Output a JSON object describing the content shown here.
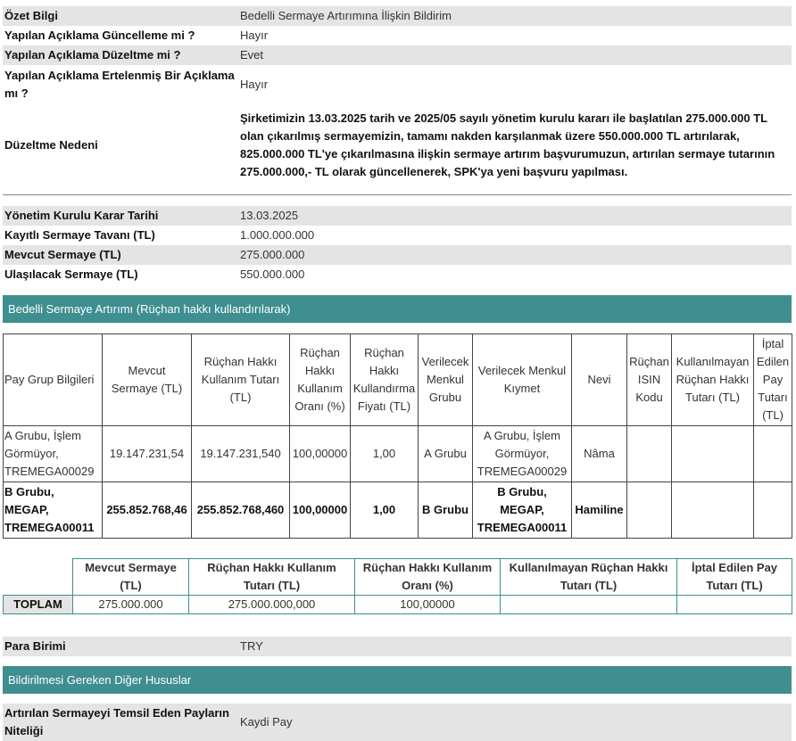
{
  "summary": {
    "rows": [
      {
        "key": "Özet Bilgi",
        "value": "Bedelli Sermaye Artırımına İlişkin Bildirim"
      },
      {
        "key": "Yapılan Açıklama Güncelleme mi ?",
        "value": "Hayır"
      },
      {
        "key": "Yapılan Açıklama Düzeltme mi ?",
        "value": "Evet"
      },
      {
        "key": "Yapılan Açıklama Ertelenmiş Bir Açıklama mı ?",
        "value": "Hayır"
      }
    ],
    "correction": {
      "key": "Düzeltme Nedeni",
      "value": "Şirketimizin 13.03.2025 tarih ve 2025/05 sayılı yönetim kurulu kararı ile başlatılan 275.000.000 TL olan çıkarılmış sermayemizin, tamamı nakden karşılanmak üzere 550.000.000 TL artırılarak, 825.000.000 TL'ye çıkarılmasına ilişkin sermaye artırım başvurumuzun, artırılan sermaye tutarının 275.000.000,- TL olarak güncellenerek, SPK'ya yeni başvuru yapılması."
    }
  },
  "capital": {
    "rows": [
      {
        "key": "Yönetim Kurulu Karar Tarihi",
        "value": "13.03.2025"
      },
      {
        "key": "Kayıtlı Sermaye Tavanı (TL)",
        "value": "1.000.000.000"
      },
      {
        "key": "Mevcut Sermaye (TL)",
        "value": "275.000.000"
      },
      {
        "key": "Ulaşılacak Sermaye (TL)",
        "value": "550.000.000"
      }
    ]
  },
  "rights_section": {
    "title": "Bedelli Sermaye Artırımı (Rüçhan hakkı kullandırılarak)",
    "headers": [
      "Pay Grup Bilgileri",
      "Mevcut Sermaye (TL)",
      "Rüçhan Hakkı Kullanım Tutarı (TL)",
      "Rüçhan Hakkı Kullanım Oranı (%)",
      "Rüçhan Hakkı Kullandırma Fiyatı (TL)",
      "Verilecek Menkul Grubu",
      "Verilecek Menkul Kıymet",
      "Nevi",
      "Rüçhan ISIN Kodu",
      "Kullanılmayan Rüçhan Hakkı Tutarı (TL)",
      "İptal Edilen Pay Tutarı (TL)"
    ],
    "rows": [
      [
        "A Grubu, İşlem Görmüyor, TREMEGA00029",
        "19.147.231,54",
        "19.147.231,540",
        "100,00000",
        "1,00",
        "A Grubu",
        "A Grubu, İşlem Görmüyor, TREMEGA00029",
        "Nâma",
        "",
        "",
        ""
      ],
      [
        "B Grubu, MEGAP, TREMEGA00011",
        "255.852.768,46",
        "255.852.768,460",
        "100,00000",
        "1,00",
        "B Grubu",
        "B Grubu, MEGAP, TREMEGA00011",
        "Hamiline",
        "",
        "",
        ""
      ]
    ]
  },
  "total": {
    "headers": [
      "Mevcut Sermaye (TL)",
      "Rüçhan Hakkı Kullanım Tutarı (TL)",
      "Rüçhan Hakkı Kullanım Oranı (%)",
      "Kullanılmayan Rüçhan Hakkı Tutarı (TL)",
      "İptal Edilen Pay Tutarı (TL)"
    ],
    "label": "TOPLAM",
    "values": [
      "275.000.000",
      "275.000.000,000",
      "100,00000",
      "",
      ""
    ]
  },
  "currency": {
    "key": "Para Birimi",
    "value": "TRY"
  },
  "other_section": {
    "title": "Bildirilmesi Gereken Diğer Hususlar"
  },
  "share_nature": {
    "key": "Artırılan Sermayeyi Temsil Eden Payların Niteliği",
    "value": "Kaydi Pay"
  },
  "colors": {
    "accent": "#3f8e90",
    "row_gray": "#e4e4e4"
  }
}
